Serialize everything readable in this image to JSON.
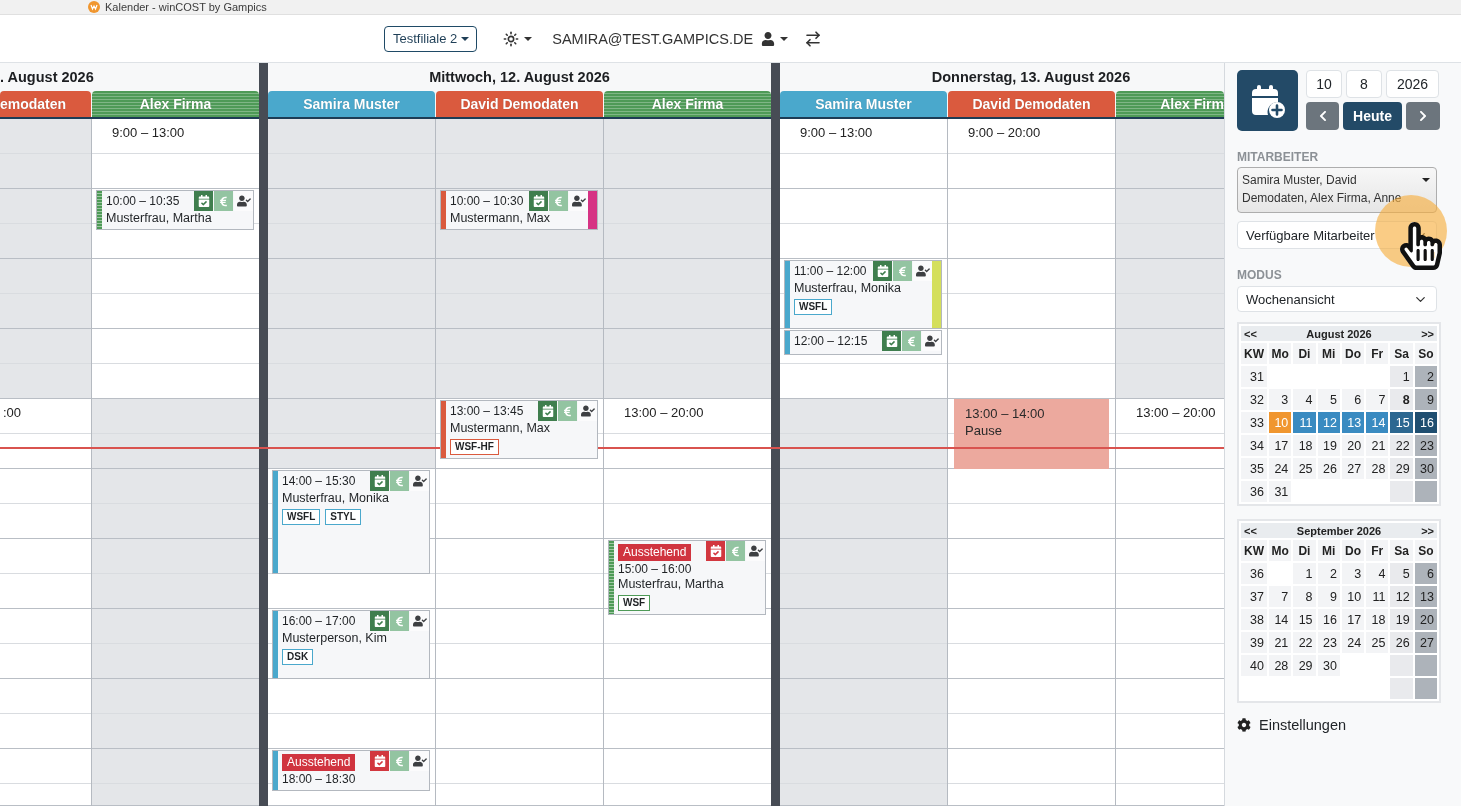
{
  "browser_tab": {
    "title": "Kalender - winCOST by Gampics"
  },
  "toolbar": {
    "branch": "Testfiliale 2",
    "user": "SAMIRA@TEST.GAMPICS.DE"
  },
  "calendar": {
    "now_indicator": {
      "level": 0.477
    },
    "days": [
      {
        "title": ". August 2026",
        "columns": [
          {
            "employee": "emodaten",
            "color": "#da5a3e",
            "striped": false,
            "hours": [
              {
                "available": false
              },
              {
                "available": false
              },
              {
                "available": false
              },
              {
                "available": false
              },
              {
                "available": true,
                "label": ":00"
              },
              {
                "available": true
              },
              {
                "available": true
              },
              {
                "available": true
              },
              {
                "available": true
              },
              {
                "available": true
              }
            ]
          },
          {
            "employee": "Alex Firma",
            "color": "#4e9a57",
            "striped": true,
            "hours": [
              {
                "available": true,
                "label": "9:00 – 13:00"
              },
              {
                "available": true
              },
              {
                "available": true
              },
              {
                "available": true
              },
              {
                "available": false
              },
              {
                "available": false
              },
              {
                "available": false
              },
              {
                "available": false
              },
              {
                "available": false
              },
              {
                "available": false
              }
            ],
            "events": [
              {
                "kind": "appointment",
                "time": "10:00 – 10:35",
                "client": "Musterfrau, Martha"
              }
            ]
          }
        ]
      },
      {
        "title": "Mittwoch, 12. August 2026",
        "columns": [
          {
            "employee": "Samira Muster",
            "color": "#4aa8cc",
            "striped": false,
            "hours": [
              {
                "available": false
              },
              {
                "available": false
              },
              {
                "available": false
              },
              {
                "available": false
              },
              {
                "available": false
              },
              {
                "available": true
              },
              {
                "available": true
              },
              {
                "available": true
              },
              {
                "available": true
              },
              {
                "available": true
              }
            ],
            "events": [
              {
                "kind": "appointment",
                "time": "14:00 – 15:30",
                "client": "Musterfrau, Monika",
                "tags": [
                  "WSFL",
                  "STYL"
                ]
              },
              {
                "kind": "appointment",
                "time": "16:00 – 17:00",
                "client": "Musterperson, Kim",
                "tags": [
                  "DSK"
                ]
              },
              {
                "kind": "appointment",
                "badge": "Ausstehend",
                "time": "18:00 – 18:30"
              }
            ]
          },
          {
            "employee": "David Demodaten",
            "color": "#da5a3e",
            "striped": false,
            "hours": [
              {
                "available": false
              },
              {
                "available": false
              },
              {
                "available": false
              },
              {
                "available": false
              },
              {
                "available": true
              },
              {
                "available": true
              },
              {
                "available": true
              },
              {
                "available": true
              },
              {
                "available": true
              },
              {
                "available": true
              }
            ],
            "events": [
              {
                "kind": "appointment",
                "time": "10:00 – 10:30",
                "client": "Mustermann, Max",
                "color": "#d63384"
              },
              {
                "kind": "appointment",
                "time": "13:00 – 13:45",
                "client": "Mustermann, Max",
                "tags": [
                  "WSF-HF"
                ]
              }
            ]
          },
          {
            "employee": "Alex Firma",
            "color": "#4e9a57",
            "striped": true,
            "hours": [
              {
                "available": false
              },
              {
                "available": false
              },
              {
                "available": false
              },
              {
                "available": false
              },
              {
                "available": true,
                "label": "13:00 – 20:00"
              },
              {
                "available": true
              },
              {
                "available": true
              },
              {
                "available": true
              },
              {
                "available": true
              },
              {
                "available": true
              }
            ],
            "events": [
              {
                "kind": "appointment",
                "badge": "Ausstehend",
                "time": "15:00 – 16:00",
                "client": "Musterfrau, Martha",
                "tags": [
                  "WSF"
                ]
              }
            ]
          }
        ]
      },
      {
        "title": "Donnerstag, 13. August 2026",
        "columns": [
          {
            "employee": "Samira Muster",
            "color": "#4aa8cc",
            "striped": false,
            "hours": [
              {
                "available": true,
                "label": "9:00 – 13:00"
              },
              {
                "available": true
              },
              {
                "available": true
              },
              {
                "available": true
              },
              {
                "available": false
              },
              {
                "available": false
              },
              {
                "available": false
              },
              {
                "available": false
              },
              {
                "available": false
              },
              {
                "available": false
              }
            ],
            "events": [
              {
                "kind": "appointment",
                "time": "11:00 – 12:00",
                "client": "Musterfrau, Monika",
                "tags": [
                  "WSFL"
                ],
                "color": "#d4df5c"
              },
              {
                "kind": "appointment",
                "time": "12:00 – 12:15"
              }
            ]
          },
          {
            "employee": "David Demodaten",
            "color": "#da5a3e",
            "striped": false,
            "hours": [
              {
                "available": true,
                "label": "9:00 – 20:00"
              },
              {
                "available": true
              },
              {
                "available": true
              },
              {
                "available": true
              },
              {
                "available": true
              },
              {
                "available": true
              },
              {
                "available": true
              },
              {
                "available": true
              },
              {
                "available": true
              },
              {
                "available": true
              }
            ],
            "events": [
              {
                "kind": "break",
                "time": "13:00 – 14:00",
                "label": "Pause"
              }
            ]
          },
          {
            "employee": "Alex Firm",
            "color": "#4e9a57",
            "striped": true,
            "hours": [
              {
                "available": false
              },
              {
                "available": false
              },
              {
                "available": false
              },
              {
                "available": false
              },
              {
                "available": true,
                "label": "13:00 – 20:00"
              },
              {
                "available": true
              },
              {
                "available": true
              },
              {
                "available": true
              },
              {
                "available": true
              },
              {
                "available": true
              }
            ]
          }
        ]
      }
    ]
  },
  "sidebar": {
    "date": {
      "day": "10",
      "month": "8",
      "year": "2026"
    },
    "today_button": "Heute",
    "employees": {
      "label": "MITARBEITER",
      "value": "Samira Muster, David Demodaten, Alex Firma, Anne"
    },
    "availability": {
      "value": "Verfügbare Mitarbeiter"
    },
    "mode": {
      "label": "MODUS",
      "value": "Wochenansicht"
    },
    "months": [
      {
        "prev": "<<",
        "title": "August 2026",
        "next": ">>",
        "headers": [
          "KW",
          "Mo",
          "Di",
          "Mi",
          "Do",
          "Fr",
          "Sa",
          "So"
        ],
        "weeks": [
          {
            "week": "31",
            "days": [
              {
                "kind": "blank"
              },
              {
                "kind": "blank"
              },
              {
                "kind": "blank"
              },
              {
                "kind": "blank"
              },
              {
                "kind": "blank"
              },
              {
                "kind": "day",
                "label": "1",
                "selected": false,
                "today": false,
                "marked": false
              },
              {
                "kind": "day",
                "label": "2",
                "selected": false,
                "today": false,
                "marked": false
              }
            ]
          },
          {
            "week": "32",
            "days": [
              {
                "kind": "day",
                "label": "3",
                "selected": false,
                "today": false,
                "marked": false
              },
              {
                "kind": "day",
                "label": "4",
                "selected": false,
                "today": false,
                "marked": false
              },
              {
                "kind": "day",
                "label": "5",
                "selected": false,
                "today": false,
                "marked": false
              },
              {
                "kind": "day",
                "label": "6",
                "selected": false,
                "today": false,
                "marked": false
              },
              {
                "kind": "day",
                "label": "7",
                "selected": false,
                "today": false,
                "marked": false
              },
              {
                "kind": "day",
                "label": "8",
                "selected": false,
                "today": false,
                "marked": true
              },
              {
                "kind": "day",
                "label": "9",
                "selected": false,
                "today": false,
                "marked": false
              }
            ]
          },
          {
            "week": "33",
            "days": [
              {
                "kind": "day",
                "label": "10",
                "selected": true,
                "today": true,
                "marked": false
              },
              {
                "kind": "day",
                "label": "11",
                "selected": true,
                "today": false,
                "marked": false
              },
              {
                "kind": "day",
                "label": "12",
                "selected": true,
                "today": false,
                "marked": false
              },
              {
                "kind": "day",
                "label": "13",
                "selected": true,
                "today": false,
                "marked": false
              },
              {
                "kind": "day",
                "label": "14",
                "selected": true,
                "today": false,
                "marked": false
              },
              {
                "kind": "day",
                "label": "15",
                "selected": true,
                "today": false,
                "marked": false
              },
              {
                "kind": "day",
                "label": "16",
                "selected": true,
                "today": false,
                "marked": false
              }
            ]
          },
          {
            "week": "34",
            "days": [
              {
                "kind": "day",
                "label": "17",
                "selected": false,
                "today": false,
                "marked": false
              },
              {
                "kind": "day",
                "label": "18",
                "selected": false,
                "today": false,
                "marked": false
              },
              {
                "kind": "day",
                "label": "19",
                "selected": false,
                "today": false,
                "marked": false
              },
              {
                "kind": "day",
                "label": "20",
                "selected": false,
                "today": false,
                "marked": false
              },
              {
                "kind": "day",
                "label": "21",
                "selected": false,
                "today": false,
                "marked": false
              },
              {
                "kind": "day",
                "label": "22",
                "selected": false,
                "today": false,
                "marked": false
              },
              {
                "kind": "day",
                "label": "23",
                "selected": false,
                "today": false,
                "marked": false
              }
            ]
          },
          {
            "week": "35",
            "days": [
              {
                "kind": "day",
                "label": "24",
                "selected": false,
                "today": false,
                "marked": false
              },
              {
                "kind": "day",
                "label": "25",
                "selected": false,
                "today": false,
                "marked": false
              },
              {
                "kind": "day",
                "label": "26",
                "selected": false,
                "today": false,
                "marked": false
              },
              {
                "kind": "day",
                "label": "27",
                "selected": false,
                "today": false,
                "marked": false
              },
              {
                "kind": "day",
                "label": "28",
                "selected": false,
                "today": false,
                "marked": false
              },
              {
                "kind": "day",
                "label": "29",
                "selected": false,
                "today": false,
                "marked": false
              },
              {
                "kind": "day",
                "label": "30",
                "selected": false,
                "today": false,
                "marked": false
              }
            ]
          },
          {
            "week": "36",
            "days": [
              {
                "kind": "day",
                "label": "31",
                "selected": false,
                "today": false,
                "marked": false
              },
              {
                "kind": "blank"
              },
              {
                "kind": "blank"
              },
              {
                "kind": "blank"
              },
              {
                "kind": "blank"
              },
              {
                "kind": "blank"
              },
              {
                "kind": "blank"
              }
            ]
          }
        ]
      },
      {
        "prev": "<<",
        "title": "September 2026",
        "next": ">>",
        "headers": [
          "KW",
          "Mo",
          "Di",
          "Mi",
          "Do",
          "Fr",
          "Sa",
          "So"
        ],
        "weeks": [
          {
            "week": "36",
            "days": [
              {
                "kind": "blank"
              },
              {
                "kind": "day",
                "label": "1",
                "selected": false,
                "today": false,
                "marked": false
              },
              {
                "kind": "day",
                "label": "2",
                "selected": false,
                "today": false,
                "marked": false
              },
              {
                "kind": "day",
                "label": "3",
                "selected": false,
                "today": false,
                "marked": false
              },
              {
                "kind": "day",
                "label": "4",
                "selected": false,
                "today": false,
                "marked": false
              },
              {
                "kind": "day",
                "label": "5",
                "selected": false,
                "today": false,
                "marked": false
              },
              {
                "kind": "day",
                "label": "6",
                "selected": false,
                "today": false,
                "marked": false
              }
            ]
          },
          {
            "week": "37",
            "days": [
              {
                "kind": "day",
                "label": "7",
                "selected": false,
                "today": false,
                "marked": false
              },
              {
                "kind": "day",
                "label": "8",
                "selected": false,
                "today": false,
                "marked": false
              },
              {
                "kind": "day",
                "label": "9",
                "selected": false,
                "today": false,
                "marked": false
              },
              {
                "kind": "day",
                "label": "10",
                "selected": false,
                "today": false,
                "marked": false
              },
              {
                "kind": "day",
                "label": "11",
                "selected": false,
                "today": false,
                "marked": false
              },
              {
                "kind": "day",
                "label": "12",
                "selected": false,
                "today": false,
                "marked": false
              },
              {
                "kind": "day",
                "label": "13",
                "selected": false,
                "today": false,
                "marked": false
              }
            ]
          },
          {
            "week": "38",
            "days": [
              {
                "kind": "day",
                "label": "14",
                "selected": false,
                "today": false,
                "marked": false
              },
              {
                "kind": "day",
                "label": "15",
                "selected": false,
                "today": false,
                "marked": false
              },
              {
                "kind": "day",
                "label": "16",
                "selected": false,
                "today": false,
                "marked": false
              },
              {
                "kind": "day",
                "label": "17",
                "selected": false,
                "today": false,
                "marked": false
              },
              {
                "kind": "day",
                "label": "18",
                "selected": false,
                "today": false,
                "marked": false
              },
              {
                "kind": "day",
                "label": "19",
                "selected": false,
                "today": false,
                "marked": false
              },
              {
                "kind": "day",
                "label": "20",
                "selected": false,
                "today": false,
                "marked": false
              }
            ]
          },
          {
            "week": "39",
            "days": [
              {
                "kind": "day",
                "label": "21",
                "selected": false,
                "today": false,
                "marked": false
              },
              {
                "kind": "day",
                "label": "22",
                "selected": false,
                "today": false,
                "marked": false
              },
              {
                "kind": "day",
                "label": "23",
                "selected": false,
                "today": false,
                "marked": false
              },
              {
                "kind": "day",
                "label": "24",
                "selected": false,
                "today": false,
                "marked": false
              },
              {
                "kind": "day",
                "label": "25",
                "selected": false,
                "today": false,
                "marked": false
              },
              {
                "kind": "day",
                "label": "26",
                "selected": false,
                "today": false,
                "marked": false
              },
              {
                "kind": "day",
                "label": "27",
                "selected": false,
                "today": false,
                "marked": false
              }
            ]
          },
          {
            "week": "40",
            "days": [
              {
                "kind": "day",
                "label": "28",
                "selected": false,
                "today": false,
                "marked": false
              },
              {
                "kind": "day",
                "label": "29",
                "selected": false,
                "today": false,
                "marked": false
              },
              {
                "kind": "day",
                "label": "30",
                "selected": false,
                "today": false,
                "marked": false
              },
              {
                "kind": "blank"
              },
              {
                "kind": "blank"
              },
              {
                "kind": "blank"
              },
              {
                "kind": "blank"
              }
            ]
          },
          {
            "days": [
              {
                "kind": "blank"
              },
              {
                "kind": "blank"
              },
              {
                "kind": "blank"
              },
              {
                "kind": "blank"
              },
              {
                "kind": "blank"
              },
              {
                "kind": "blank"
              },
              {
                "kind": "blank"
              }
            ]
          }
        ]
      }
    ],
    "settings": "Einstellungen"
  }
}
